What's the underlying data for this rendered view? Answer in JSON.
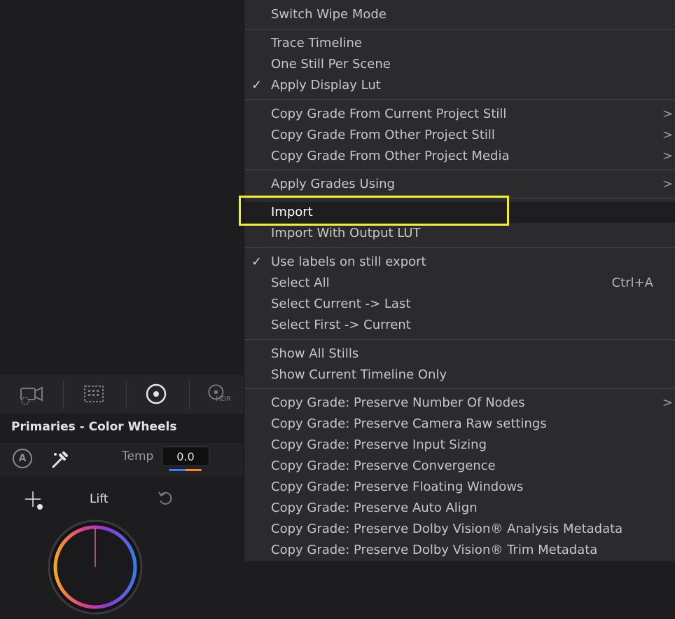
{
  "panel": {
    "title": "Primaries - Color Wheels",
    "temp_label": "Temp",
    "temp_value": "0.0",
    "auto_label": "A",
    "wheel_label": "Lift",
    "hdr_label": "HDR"
  },
  "menu": {
    "items": [
      {
        "label": "Switch Wipe Mode"
      },
      {
        "label": "Trace Timeline"
      },
      {
        "label": "One Still Per Scene"
      },
      {
        "label": "Apply Display Lut",
        "checked": true
      },
      {
        "label": "Copy Grade From Current Project Still",
        "submenu": true
      },
      {
        "label": "Copy Grade From Other Project Still",
        "submenu": true
      },
      {
        "label": "Copy Grade From Other Project Media",
        "submenu": true
      },
      {
        "label": "Apply Grades Using",
        "submenu": true
      },
      {
        "label": "Import",
        "highlighted": true
      },
      {
        "label": "Import With Output LUT"
      },
      {
        "label": "Use labels on still export",
        "checked": true
      },
      {
        "label": "Select All",
        "shortcut": "Ctrl+A"
      },
      {
        "label": "Select Current -> Last"
      },
      {
        "label": "Select First -> Current"
      },
      {
        "label": "Show All Stills"
      },
      {
        "label": "Show Current Timeline Only"
      },
      {
        "label": "Copy Grade: Preserve Number Of Nodes",
        "submenu": true
      },
      {
        "label": "Copy Grade: Preserve Camera Raw settings"
      },
      {
        "label": "Copy Grade: Preserve Input Sizing"
      },
      {
        "label": "Copy Grade: Preserve Convergence"
      },
      {
        "label": "Copy Grade: Preserve Floating Windows"
      },
      {
        "label": "Copy Grade: Preserve Auto Align"
      },
      {
        "label": "Copy Grade: Preserve Dolby Vision® Analysis Metadata"
      },
      {
        "label": "Copy Grade: Preserve Dolby Vision® Trim Metadata"
      }
    ],
    "check_glyph": "✓",
    "arrow_glyph": ">"
  },
  "colors": {
    "highlight_outline": "#f2ee2a",
    "menu_bg": "#2b2b2e",
    "app_bg": "#1d1d20"
  }
}
